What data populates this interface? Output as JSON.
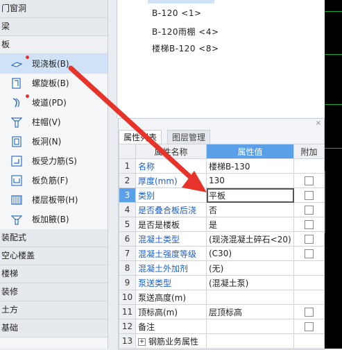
{
  "tree": {
    "categories_top": [
      {
        "label": "门窗洞"
      },
      {
        "label": "梁"
      },
      {
        "label": "板"
      }
    ],
    "slab_items": [
      {
        "label": "现浇板(B)",
        "icon": "cast-slab-icon",
        "dot": true,
        "selected": true
      },
      {
        "label": "螺旋板(B)",
        "icon": "spiral-slab-icon",
        "dot": false
      },
      {
        "label": "坡道(PD)",
        "icon": "ramp-icon",
        "dot": true
      },
      {
        "label": "柱帽(V)",
        "icon": "column-cap-icon",
        "dot": false
      },
      {
        "label": "板洞(N)",
        "icon": "slab-hole-icon",
        "dot": false
      },
      {
        "label": "板受力筋(S)",
        "icon": "slab-main-rebar-icon",
        "dot": false
      },
      {
        "label": "板负筋(F)",
        "icon": "slab-negative-rebar-icon",
        "dot": false
      },
      {
        "label": "楼层板带(H)",
        "icon": "floor-slab-strip-icon",
        "dot": false
      },
      {
        "label": "板加腋(B)",
        "icon": "slab-haunch-icon",
        "dot": false
      }
    ],
    "categories_bottom": [
      {
        "label": "装配式"
      },
      {
        "label": "空心楼盖"
      },
      {
        "label": "楼梯"
      },
      {
        "label": "装修"
      },
      {
        "label": "土方"
      },
      {
        "label": "基础"
      }
    ]
  },
  "component_list": [
    {
      "label": "B-120 <1>"
    },
    {
      "label": "B-120雨棚 <4>"
    },
    {
      "label": "楼梯B-120 <8>"
    }
  ],
  "props_panel": {
    "tabs": [
      "属性列表",
      "图层管理"
    ],
    "close": "×",
    "columns": [
      "属性名称",
      "属性值",
      "附加"
    ],
    "rows": [
      {
        "num": "1",
        "name": "名称",
        "value": "楼梯B-130",
        "blue": true,
        "checkbox": false
      },
      {
        "num": "2",
        "name": "厚度(mm)",
        "value": "130",
        "blue": true,
        "checkbox": true
      },
      {
        "num": "3",
        "name": "类别",
        "value": "平板",
        "blue": true,
        "checkbox": true
      },
      {
        "num": "4",
        "name": "是否叠合板后浇",
        "value": "否",
        "blue": true,
        "checkbox": true
      },
      {
        "num": "5",
        "name": "是否是楼板",
        "value": "是",
        "blue": false,
        "checkbox": true
      },
      {
        "num": "6",
        "name": "混凝土类型",
        "value": "(现浇混凝土碎石<20)",
        "blue": true,
        "checkbox": true
      },
      {
        "num": "7",
        "name": "混凝土强度等级",
        "value": "(C30)",
        "blue": true,
        "checkbox": true
      },
      {
        "num": "8",
        "name": "混凝土外加剂",
        "value": "(无)",
        "blue": true,
        "checkbox": false
      },
      {
        "num": "9",
        "name": "泵送类型",
        "value": "(混凝土泵)",
        "blue": true,
        "checkbox": false
      },
      {
        "num": "10",
        "name": "泵送高度(m)",
        "value": "",
        "blue": false,
        "checkbox": false
      },
      {
        "num": "11",
        "name": "顶标高(m)",
        "value": "层顶标高",
        "blue": false,
        "checkbox": true
      },
      {
        "num": "12",
        "name": "备注",
        "value": "",
        "blue": false,
        "checkbox": true
      },
      {
        "num": "13",
        "name": "钢筋业务属性",
        "value": "",
        "blue": false,
        "checkbox": false,
        "expand": true
      }
    ],
    "current_row": "3"
  },
  "colors": {
    "selection": "#cfe2f6",
    "header_accent": "#5aa0e8",
    "link_blue": "#1a5fd0",
    "arrow_red": "#e8332a"
  }
}
